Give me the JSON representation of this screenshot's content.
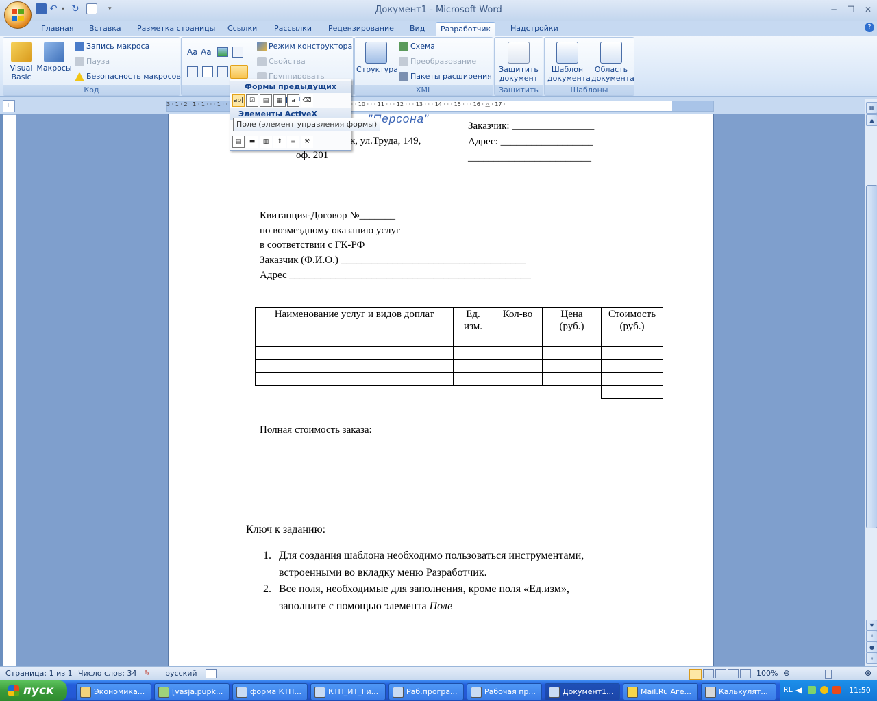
{
  "window": {
    "title": "Документ1 - Microsoft Word"
  },
  "ribbon_tabs": [
    "Главная",
    "Вставка",
    "Разметка страницы",
    "Ссылки",
    "Рассылки",
    "Рецензирование",
    "Вид",
    "Разработчик",
    "Надстройки"
  ],
  "active_tab": "Разработчик",
  "groups": {
    "code": {
      "label": "Код",
      "visual_basic": "Visual Basic",
      "macros": "Макросы",
      "record_macro": "Запись макроса",
      "pause": "Пауза",
      "macro_security": "Безопасность макросов"
    },
    "controls": {
      "label": "Э",
      "design_mode": "Режим конструктора",
      "properties": "Свойства",
      "group": "Группировать"
    },
    "xml": {
      "label": "XML",
      "structure": "Структура",
      "schema": "Схема",
      "transform": "Преобразование",
      "expansion_packs": "Пакеты расширения"
    },
    "protect": {
      "label": "Защитить",
      "protect_document": "Защитить документ"
    },
    "templates": {
      "label": "Шаблоны",
      "document_template": "Шаблон документа",
      "document_panel": "Область документа"
    }
  },
  "ruler": {
    "ticks": "3 · 1 · 2 · 1 · 1 · · · 1 · · · 2 · · · 3 · · · 4 · · · 5 · · · 6 · · · 7 · · · 8 · · · 9 · · · 10 · · · 11 · · · 12 · · · 13 · · · 14 · · · 15 · · · 16 · △ · 17 · ·",
    "corner": "L"
  },
  "controls_menu": {
    "legacy_header": "Формы предыдущих версий",
    "activex_header": "Элементы ActiveX",
    "tooltip": "Поле (элемент управления формы)"
  },
  "document": {
    "logo_text": "\"Персона\"",
    "address1": "к, ул.Труда, 149,",
    "address2": "оф. 201",
    "customer": "Заказчик: ________________",
    "address_field": "Адрес: __________________",
    "blank_line": "________________________",
    "heading_lines": [
      "Квитанция-Договор №_______",
      "по возмездному оказанию услуг",
      "в соответствии с ГК-РФ",
      "Заказчик (Ф.И.О.) ____________________________________",
      "Адрес _______________________________________________"
    ],
    "table": {
      "headers": [
        "Наименование услуг и видов доплат",
        "Ед. изм.",
        "Кол-во",
        "Цена (руб.)",
        "Стоимость (руб.)"
      ]
    },
    "total_label": "Полная стоимость заказа:",
    "key_title": "Ключ к заданию:",
    "key_items": [
      {
        "num": "1.",
        "line1": "Для создания шаблона необходимо пользоваться инструментами,",
        "line2": "встроенными во вкладку меню Разработчик."
      },
      {
        "num": "2.",
        "line1": "Все поля, необходимые для заполнения, кроме поля «Ед.изм»,",
        "line2": "заполните с помощью элемента ",
        "line2_italic": "Поле"
      }
    ]
  },
  "statusbar": {
    "page": "Страница: 1 из 1",
    "words": "Число слов: 34",
    "language": "русский",
    "zoom": "100%"
  },
  "taskbar": {
    "start": "пуск",
    "items": [
      "Экономика...",
      "[vasja.pupk...",
      "форма КТП...",
      "КТП_ИТ_Ги...",
      "Раб.програ...",
      "Рабочая пр...",
      "Документ1...",
      "Mail.Ru Аге...",
      "Калькулят..."
    ],
    "lang": "RL",
    "time": "11:50"
  },
  "colors": {
    "ribbon_text": "#15428b",
    "taskbar": "#245edb",
    "start": "#3a9b3a"
  }
}
